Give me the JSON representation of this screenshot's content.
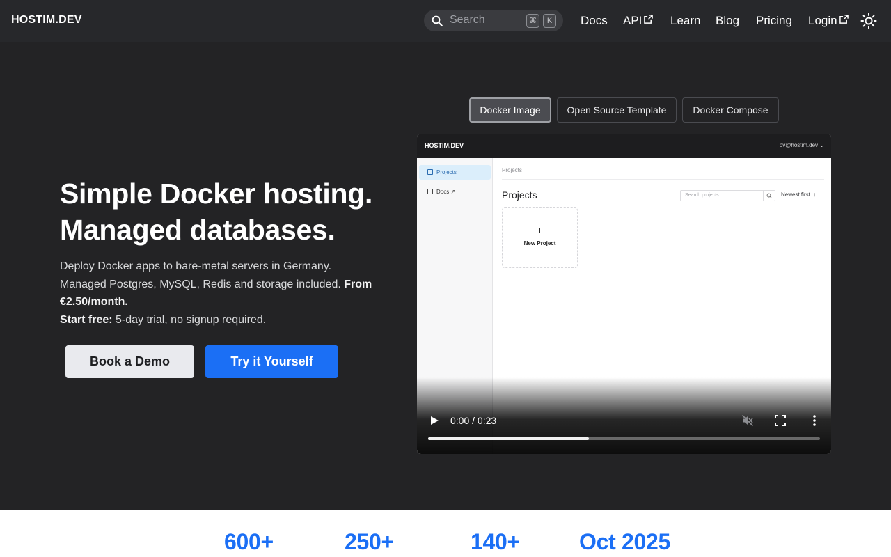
{
  "nav": {
    "brand": "HOSTIM.DEV",
    "search_placeholder": "Search",
    "shortcut_keys": [
      "⌘",
      "K"
    ],
    "links": [
      {
        "label": "Docs",
        "external": false
      },
      {
        "label": "API",
        "external": true
      },
      {
        "label": "Learn",
        "external": false
      },
      {
        "label": "Blog",
        "external": false
      },
      {
        "label": "Pricing",
        "external": false
      },
      {
        "label": "Login",
        "external": true
      }
    ],
    "theme_icon": "sun-icon"
  },
  "hero": {
    "title_line1": "Simple Docker hosting.",
    "title_line2": "Managed databases.",
    "desc_line1": "Deploy Docker apps to bare-metal servers in Germany.",
    "desc_line2": "Managed Postgres, MySQL, Redis and storage included.",
    "price": "From €2.50/month.",
    "trial_label": "Start free:",
    "trial_text": "5-day trial, no signup required.",
    "btn_demo": "Book a Demo",
    "btn_try": "Try it Yourself"
  },
  "tabs": [
    {
      "label": "Docker Image",
      "active": true
    },
    {
      "label": "Open Source Template",
      "active": false
    },
    {
      "label": "Docker Compose",
      "active": false
    }
  ],
  "video": {
    "app_brand": "HOSTIM.DEV",
    "user": "pv@hostim.dev",
    "sidebar": [
      {
        "label": "Projects",
        "active": true
      },
      {
        "label": "Docs",
        "active": false
      }
    ],
    "breadcrumb": "Projects",
    "heading": "Projects",
    "search_placeholder": "Search projects...",
    "sort": "Newest first",
    "new_project_symbol": "+",
    "new_project_label": "New Project",
    "time": "0:00 / 0:23",
    "progress_played": 0,
    "progress_buffered": 0.41
  },
  "stats": [
    "600+",
    "250+",
    "140+",
    "Oct 2025"
  ],
  "colors": {
    "accent": "#1b6ff5",
    "page_bg": "#232325",
    "nav_bg": "#27282b"
  }
}
